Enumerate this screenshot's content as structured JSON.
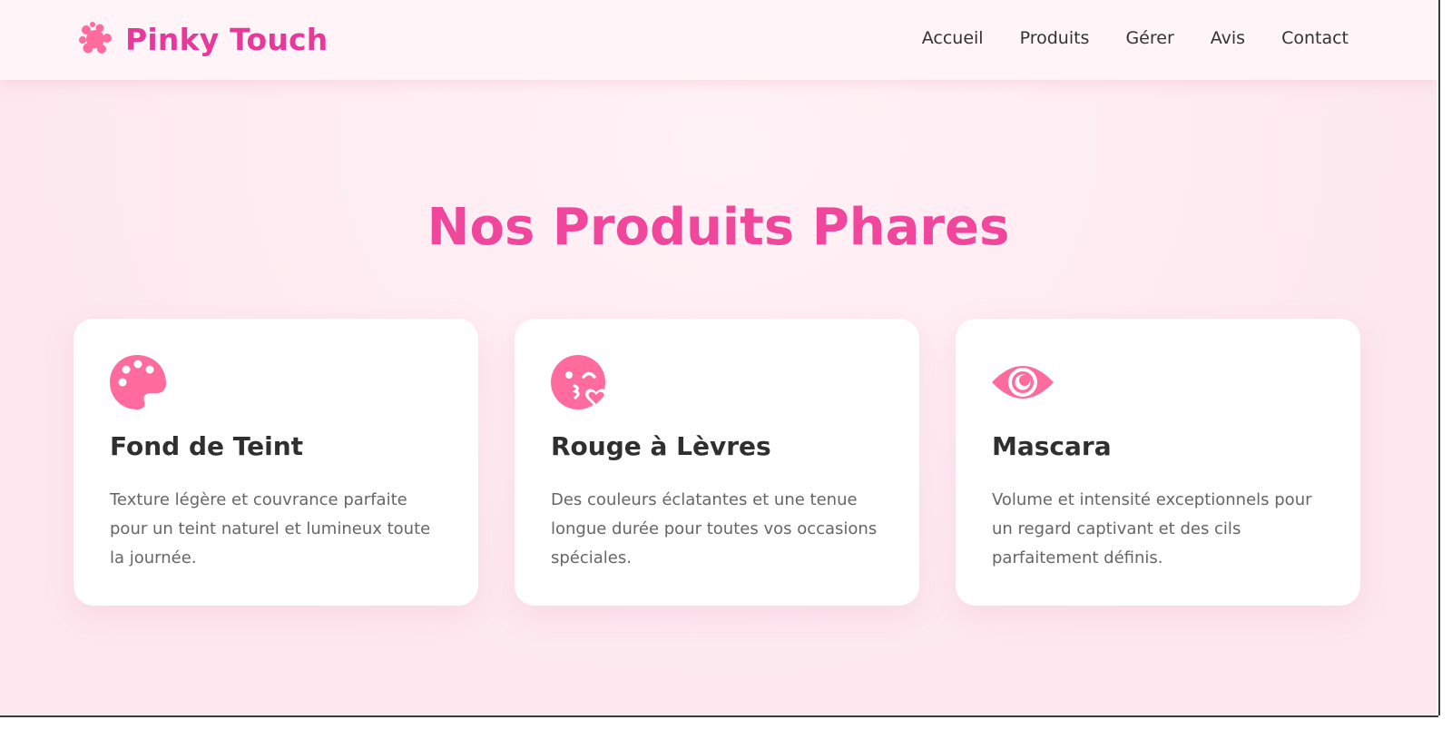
{
  "brand": {
    "name": "Pinky Touch",
    "icon": "sparkle-cluster-icon"
  },
  "nav": {
    "items": [
      "Accueil",
      "Produits",
      "Gérer",
      "Avis",
      "Contact"
    ]
  },
  "section": {
    "title": "Nos Produits Phares"
  },
  "products": [
    {
      "icon": "palette-icon",
      "title": "Fond de Teint",
      "text": "Texture légère et couvrance parfaite pour un teint naturel et lumineux toute la journée."
    },
    {
      "icon": "kiss-wink-heart-icon",
      "title": "Rouge à Lèvres",
      "text": "Des couleurs éclatantes et une tenue longue durée pour toutes vos occasions spéciales."
    },
    {
      "icon": "eye-icon",
      "title": "Mascara",
      "text": "Volume et intensité exceptionnels pour un regard captivant et des cils parfaitement définis."
    }
  ],
  "colors": {
    "brand": "#e8399a",
    "title": "#f0479c",
    "icon": "#ff6b9d",
    "background": "#fdeef3"
  }
}
